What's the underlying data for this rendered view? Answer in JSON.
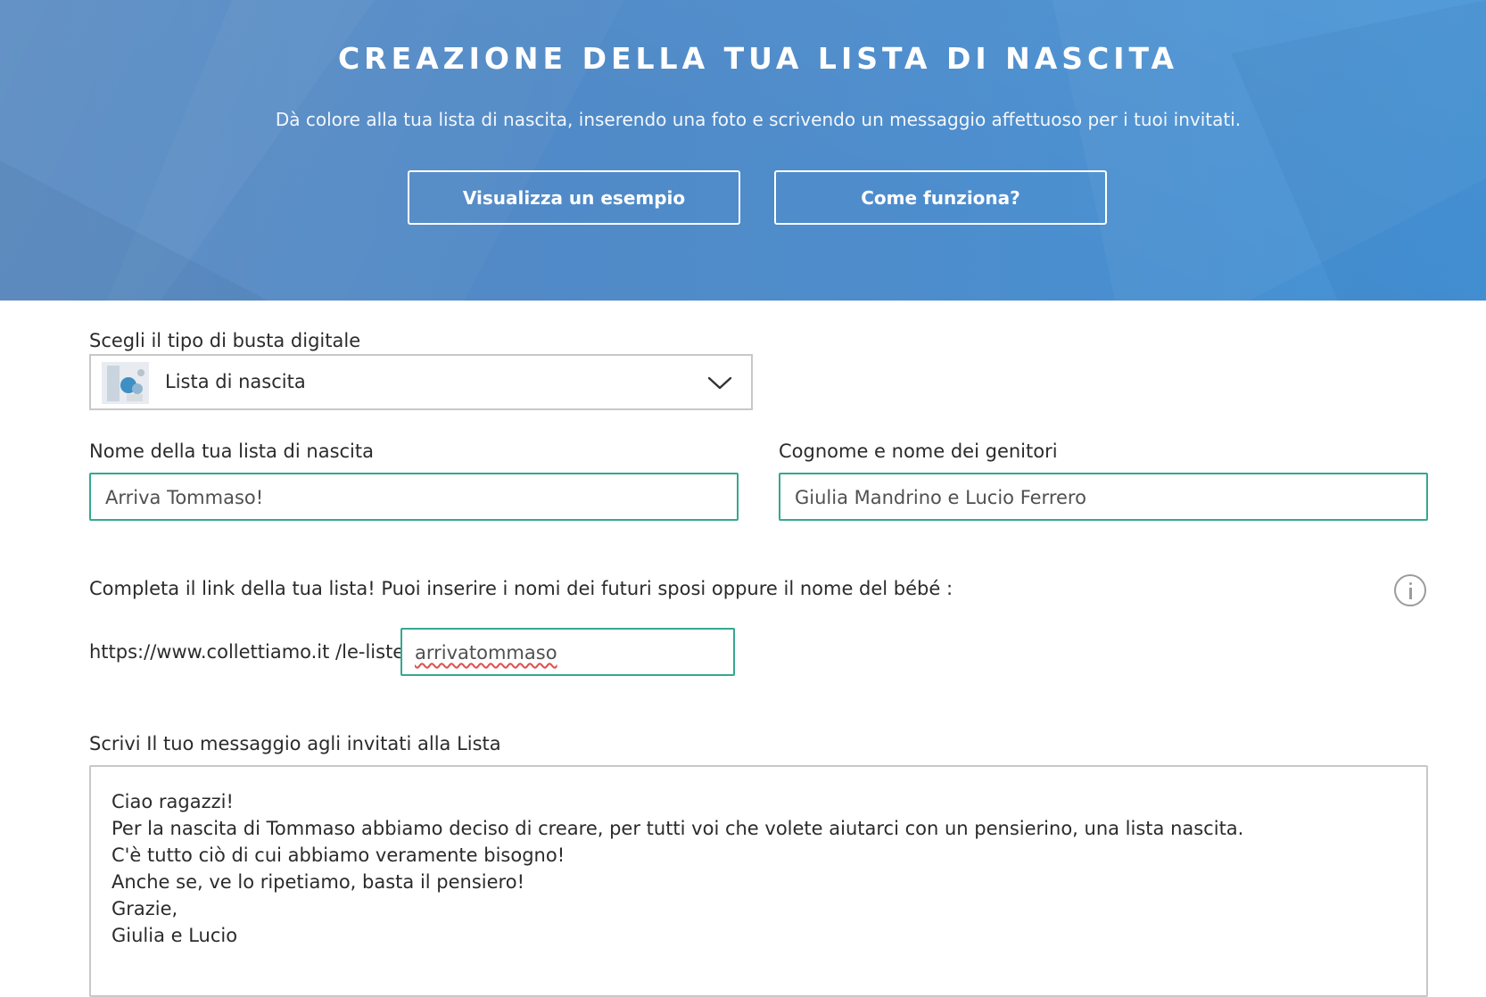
{
  "hero": {
    "title": "CREAZIONE DELLA TUA LISTA DI NASCITA",
    "subtitle": "Dà colore alla tua lista di nascita, inserendo una foto e scrivendo un messaggio affettuoso per i tuoi invitati.",
    "buttons": {
      "example": "Visualizza un esempio",
      "how": "Come funziona?"
    },
    "background_color": "#4f8ccb"
  },
  "form": {
    "type_label": "Scegli il tipo di busta digitale",
    "type_value": "Lista di nascita",
    "list_name_label": "Nome della tua lista di nascita",
    "list_name_value": "Arriva Tommaso!",
    "parents_label": "Cognome e nome dei genitori",
    "parents_value": "Giulia Mandrino e Lucio Ferrero",
    "link_label": "Completa il link della tua lista! Puoi inserire i nomi dei futuri sposi oppure il nome del bébé :",
    "link_prefix": "https://www.collettiamo.it /le-liste/",
    "link_value": "arrivatommaso",
    "message_label": "Scrivi Il tuo messaggio agli invitati alla Lista",
    "message_lines": [
      "Ciao ragazzi!",
      "Per la nascita di Tommaso abbiamo deciso di creare, per tutti voi che volete aiutarci con un pensierino, una lista nascita.",
      "C'è tutto ciò di cui abbiamo veramente bisogno!",
      "Anche se, ve lo ripetiamo, basta il pensiero!",
      "Grazie,",
      "Giulia e Lucio"
    ],
    "accent_color": "#34a88f"
  },
  "icons": {
    "chevron": "chevron-down-icon",
    "info": "info-icon",
    "thumbnail": "baby-list-thumbnail"
  }
}
